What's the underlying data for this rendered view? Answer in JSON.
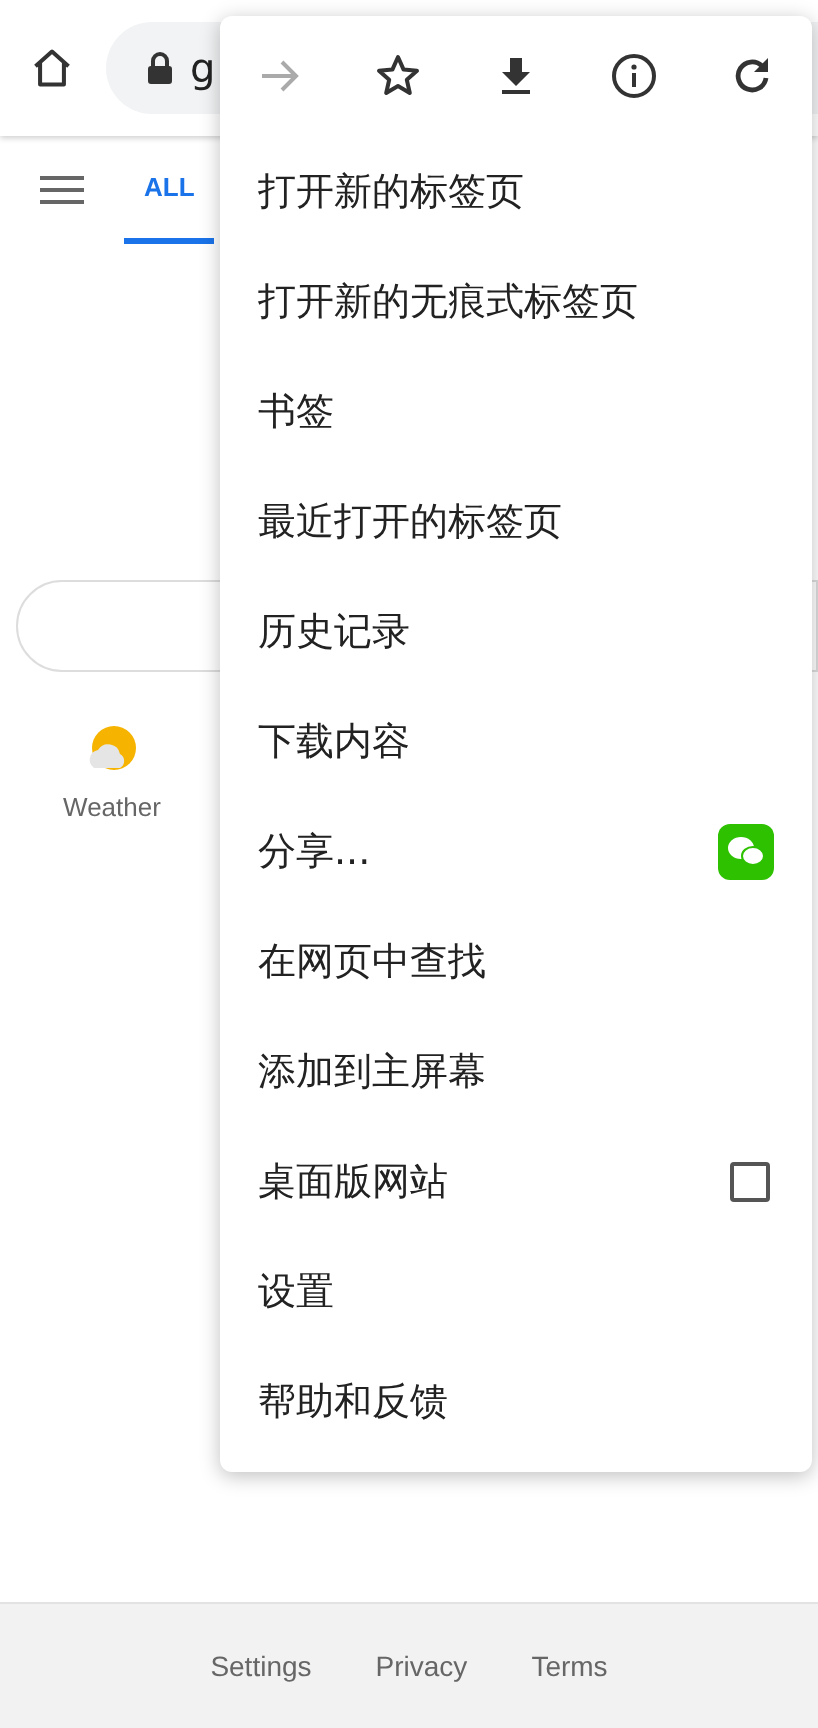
{
  "toolbar": {
    "url": "g"
  },
  "tabs": [
    {
      "label": "ALL",
      "selected": true
    }
  ],
  "shortcuts": [
    {
      "label": "Weather"
    }
  ],
  "menu": {
    "icons": [
      {
        "kind": "forward",
        "disabled": true
      },
      {
        "kind": "star",
        "disabled": false
      },
      {
        "kind": "download",
        "disabled": false
      },
      {
        "kind": "info",
        "disabled": false
      },
      {
        "kind": "reload",
        "disabled": false
      }
    ],
    "items": [
      {
        "label": "打开新的标签页",
        "kind": "plain"
      },
      {
        "label": "打开新的无痕式标签页",
        "kind": "plain"
      },
      {
        "label": "书签",
        "kind": "plain"
      },
      {
        "label": "最近打开的标签页",
        "kind": "plain"
      },
      {
        "label": "历史记录",
        "kind": "plain"
      },
      {
        "label": "下载内容",
        "kind": "plain"
      },
      {
        "label": "分享...",
        "kind": "share"
      },
      {
        "label": "在网页中查找",
        "kind": "plain"
      },
      {
        "label": "添加到主屏幕",
        "kind": "plain"
      },
      {
        "label": "桌面版网站",
        "kind": "checkbox",
        "checked": false
      },
      {
        "label": "设置",
        "kind": "plain"
      },
      {
        "label": "帮助和反馈",
        "kind": "plain"
      }
    ]
  },
  "footer": [
    "Settings",
    "Privacy",
    "Terms"
  ]
}
